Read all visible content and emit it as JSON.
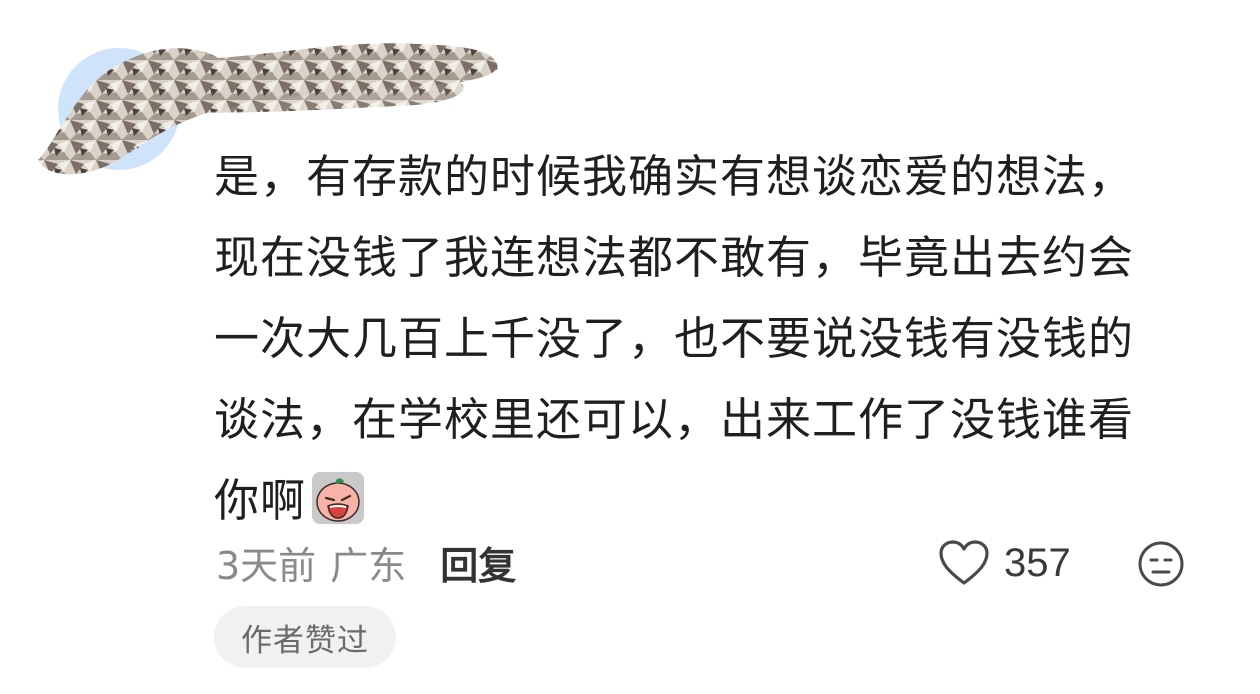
{
  "comment": {
    "lines": [
      "是，有存款的时候我确实有想谈恋爱的想法，",
      "现在没钱了我连想法都不敢有，毕竟出去约会",
      "一次大几百上千没了，也不要说没钱有没钱的",
      "谈法，在学校里还可以，出来工作了没钱谁看",
      "你啊"
    ],
    "emoji": "crying-face-emoji"
  },
  "meta": {
    "time": "3天前",
    "location": "广东",
    "reply_label": "回复"
  },
  "actions": {
    "like_icon": "heart-outline-icon",
    "like_count": "357",
    "dislike_icon": "neutral-face-icon"
  },
  "badge": {
    "label": "作者赞过"
  },
  "colors": {
    "avatar_bg": "#cfe4fb",
    "text": "#1f1f1f",
    "meta": "#8a8a8a",
    "badge_bg": "#f1f1f1"
  }
}
